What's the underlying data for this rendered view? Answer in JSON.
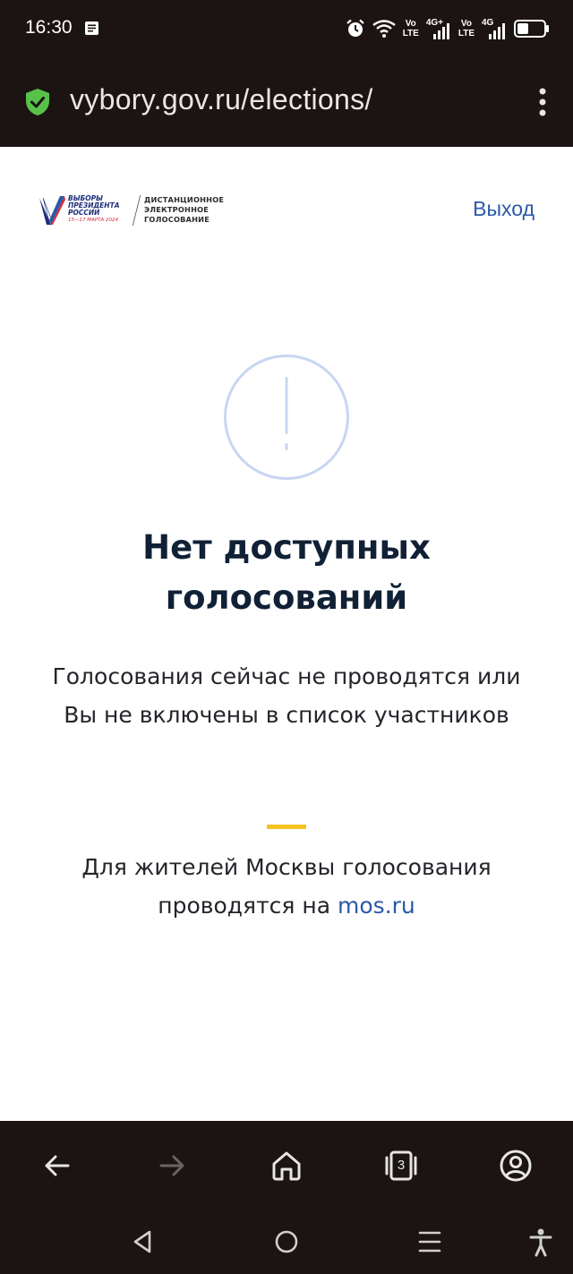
{
  "status_bar": {
    "time": "16:30",
    "network_1": "Vo LTE",
    "network_1_top": "Vo",
    "network_1_bottom": "LTE",
    "signal_1_type": "4G+",
    "network_2_top": "Vo",
    "network_2_bottom": "LTE",
    "signal_2_type": "4G",
    "icons": [
      "notification-icon",
      "alarm-icon",
      "wifi-icon",
      "signal-icon",
      "battery-icon"
    ]
  },
  "browser": {
    "url": "vybory.gov.ru/elections/",
    "tab_count": "3",
    "colors": {
      "background": "#1c1313",
      "shield": "#58c14a"
    }
  },
  "header": {
    "logo": {
      "left_lines": [
        "ВЫБОРЫ",
        "ПРЕЗИДЕНТА",
        "РОССИИ"
      ],
      "dates": "15—17 МАРТА 2024",
      "right_lines": [
        "ДИСТАНЦИОННОЕ",
        "ЭЛЕКТРОННОЕ",
        "ГОЛОСОВАНИЕ"
      ]
    },
    "logout_label": "Выход"
  },
  "main": {
    "title_line1": "Нет доступных",
    "title_line2": "голосований",
    "subtitle_line1": "Голосования сейчас не проводятся или",
    "subtitle_line2": "Вы не включены в список участников",
    "moscow_line1": "Для жителей Москвы голосования",
    "moscow_line2_prefix": "проводятся на",
    "moscow_link": "mos.ru"
  },
  "colors": {
    "accent_link": "#2b59a8",
    "title": "#102035",
    "divider_yellow": "#f5c423",
    "warning_circle": "#c9d6f2"
  }
}
